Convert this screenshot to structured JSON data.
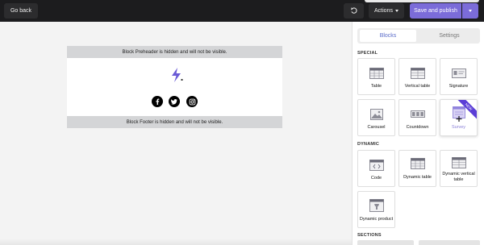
{
  "topbar": {
    "go_back_label": "Go back",
    "actions_label": "Actions",
    "save_label": "Save and publish"
  },
  "canvas": {
    "preheader_text": "Block Preheader is hidden and will not be visible.",
    "footer_text": "Block Footer is hidden and will not be visible."
  },
  "sidebar": {
    "tabs": [
      {
        "label": "Blocks",
        "active": true
      },
      {
        "label": "Settings",
        "active": false
      }
    ],
    "sections": [
      {
        "label": "SPECIAL"
      },
      {
        "label": "DYNAMIC"
      },
      {
        "label": "SECTIONS"
      }
    ],
    "special_blocks": [
      {
        "label": "Table",
        "icon": "table-icon"
      },
      {
        "label": "Vertical table",
        "icon": "vertical-table-icon"
      },
      {
        "label": "Signature",
        "icon": "signature-icon"
      },
      {
        "label": "Carousel",
        "icon": "carousel-icon"
      },
      {
        "label": "Countdown",
        "icon": "countdown-icon"
      },
      {
        "label": "Survey",
        "icon": "survey-icon",
        "badge": "NEW"
      }
    ],
    "dynamic_blocks": [
      {
        "label": "Code",
        "icon": "code-icon"
      },
      {
        "label": "Dynamic table",
        "icon": "dynamic-table-icon"
      },
      {
        "label": "Dynamic vertical table",
        "icon": "dynamic-vertical-table-icon"
      },
      {
        "label": "Dynamic product",
        "icon": "dynamic-product-icon"
      }
    ]
  },
  "colors": {
    "accent": "#7b6cd9",
    "topbar_bg": "#1c1c1e",
    "tab_active_text": "#5b6cc9",
    "badge": "#5b3ed6"
  }
}
